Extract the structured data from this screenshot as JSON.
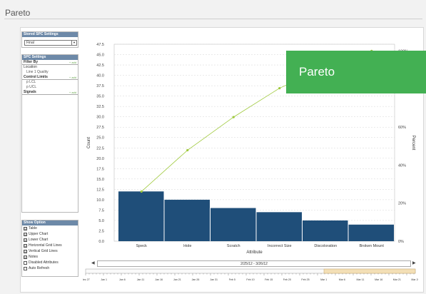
{
  "page": {
    "title": "Pareto"
  },
  "stored": {
    "header": "Stored SPC Settings",
    "value": "Final"
  },
  "spc": {
    "header": "SPC Settings",
    "filter_by": "Filter By",
    "add": "+ add",
    "location_label": "Location",
    "location_value": "Line 1 Quality",
    "control_limits": "Control Limits",
    "plcl": "p LCL",
    "pucl": "p UCL",
    "signals": "Signals"
  },
  "show": {
    "header": "Show Option",
    "options": [
      {
        "label": "Table",
        "checked": "☑"
      },
      {
        "label": "Upper Chart",
        "checked": "☑"
      },
      {
        "label": "Lower Chart",
        "checked": "☑"
      },
      {
        "label": "Horizontal Grid Lines",
        "checked": "☑"
      },
      {
        "label": "Vertical Grid Lines",
        "checked": "☑"
      },
      {
        "label": "Notes",
        "checked": "☑"
      },
      {
        "label": "Disabled Attributes",
        "checked": ""
      },
      {
        "label": "Auto Refresh",
        "checked": ""
      }
    ]
  },
  "overlay": {
    "label": "Pareto"
  },
  "range": {
    "label": "2/25/12 - 3/26/12"
  },
  "timeline": {
    "labels": [
      "Dec 27",
      "Jan 1",
      "Jan 6",
      "Jan 11",
      "Jan 16",
      "Jan 21",
      "Jan 26",
      "Jan 31",
      "Feb 5",
      "Feb 10",
      "Feb 15",
      "Feb 20",
      "Feb 25",
      "Mar 1",
      "Mar 6",
      "Mar 11",
      "Mar 16",
      "Mar 21",
      "Mar 26"
    ]
  },
  "chart_data": {
    "type": "bar",
    "categories": [
      "Speck",
      "Hole",
      "Scratch",
      "Incorrect Size",
      "Discoloration",
      "Broken Mount"
    ],
    "values": [
      12,
      10,
      8,
      7,
      5,
      4
    ],
    "cumulative_percent": [
      26.1,
      47.8,
      65.2,
      80.4,
      91.3,
      100
    ],
    "xlabel": "Attribute",
    "ylabel": "Count",
    "y2label": "Percent",
    "ylim": [
      0,
      47.5
    ],
    "yticks": [
      "0.0",
      "2.5",
      "5.0",
      "7.5",
      "10.0",
      "12.5",
      "15.0",
      "17.5",
      "20.0",
      "22.5",
      "25.0",
      "27.5",
      "30.0",
      "32.5",
      "35.0",
      "37.5",
      "40.0",
      "42.5",
      "45.0",
      "47.5"
    ],
    "y2ticks": [
      "0%",
      "20%",
      "40%",
      "60%",
      "80%",
      "100%"
    ],
    "bar_color": "#1f4e79",
    "line_color": "#9fc93c",
    "grid": true
  }
}
